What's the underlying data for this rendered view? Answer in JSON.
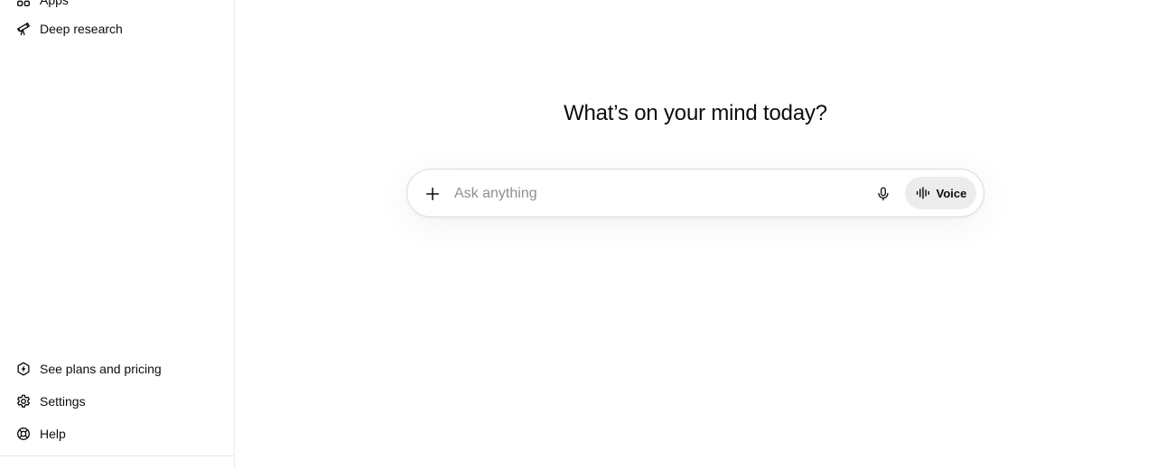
{
  "sidebar": {
    "items_top": [
      {
        "label": "Apps",
        "icon": "apps-icon"
      },
      {
        "label": "Deep research",
        "icon": "telescope-icon"
      }
    ],
    "items_bottom": [
      {
        "label": "See plans and pricing",
        "icon": "plans-icon"
      },
      {
        "label": "Settings",
        "icon": "gear-icon"
      },
      {
        "label": "Help",
        "icon": "lifebuoy-icon"
      }
    ]
  },
  "main": {
    "heading": "What’s on your mind today?",
    "composer": {
      "placeholder": "Ask anything",
      "voice_label": "Voice"
    }
  }
}
